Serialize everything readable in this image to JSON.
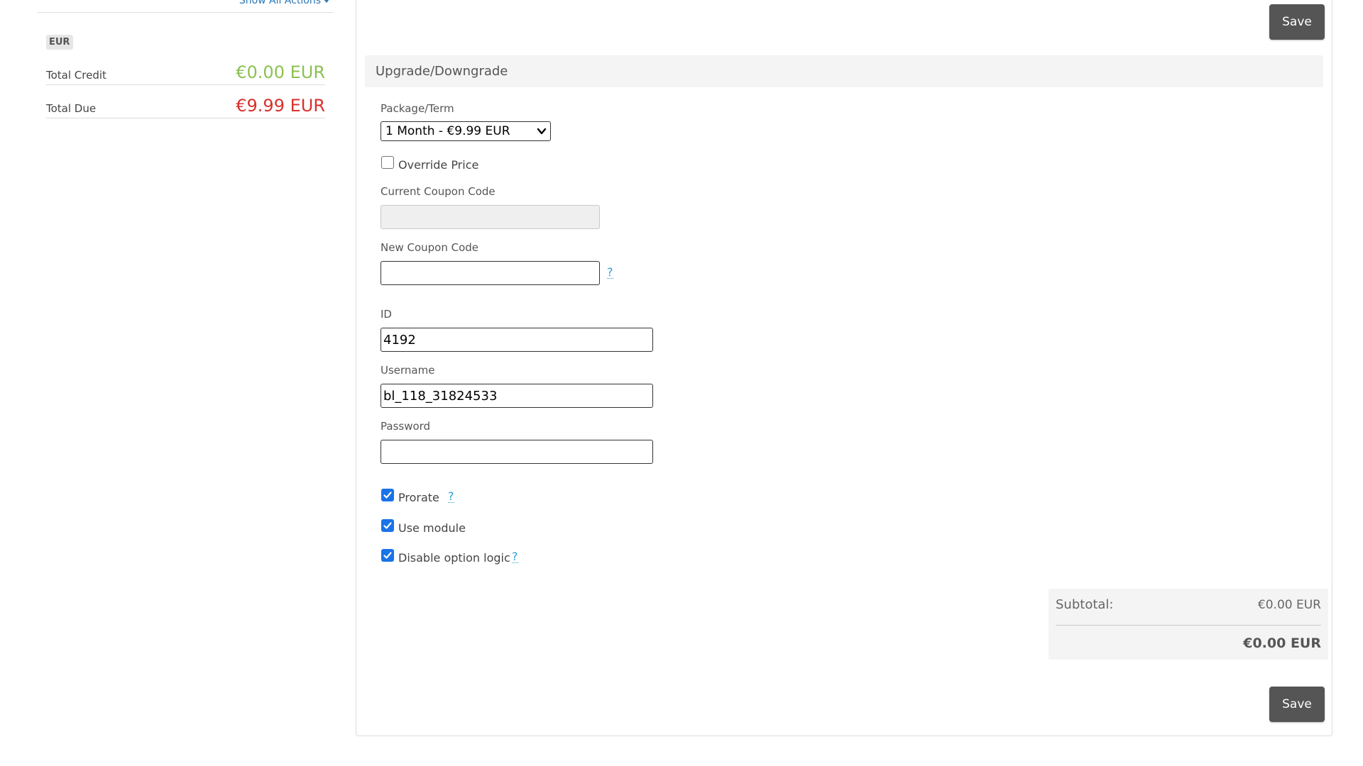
{
  "sidebar": {
    "show_all_actions": "Show All Actions",
    "currency": "EUR",
    "total_credit_label": "Total Credit",
    "total_credit_value": "€0.00 EUR",
    "total_due_label": "Total Due",
    "total_due_value": "€9.99 EUR",
    "colors": {
      "credit": "#8cc152",
      "due": "#d9302c",
      "link": "#2a77b5"
    }
  },
  "toolbar": {
    "save_label": "Save"
  },
  "upgrade": {
    "section_title": "Upgrade/Downgrade",
    "package_term_label": "Package/Term",
    "package_term_selected": "1 Month - €9.99 EUR",
    "override_price_label": "Override Price",
    "override_price_checked": false,
    "current_coupon_label": "Current Coupon Code",
    "current_coupon_value": "",
    "new_coupon_label": "New Coupon Code",
    "new_coupon_value": "",
    "help_symbol": "?"
  },
  "account": {
    "id_label": "ID",
    "id_value": "4192",
    "username_label": "Username",
    "username_value": "bl_118_31824533",
    "password_label": "Password",
    "password_value": ""
  },
  "options": {
    "prorate_label": "Prorate",
    "prorate_checked": true,
    "use_module_label": "Use module",
    "use_module_checked": true,
    "disable_option_logic_label": "Disable option logic",
    "disable_option_logic_checked": true
  },
  "totals": {
    "subtotal_label": "Subtotal:",
    "subtotal_value": "€0.00 EUR",
    "total_value": "€0.00 EUR"
  }
}
